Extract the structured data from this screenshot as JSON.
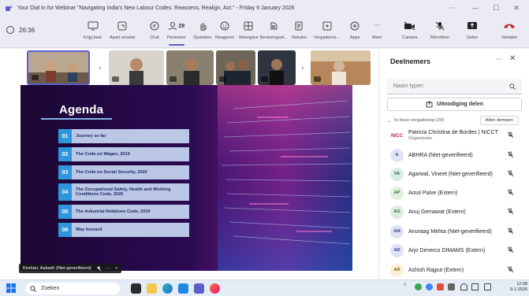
{
  "window": {
    "title": "Your Dial In for Webinar \"Navigating India's New Labour Codes: Reassess, Realign, Act.\" - Friday 9 January 2026",
    "controls": [
      "···",
      "—",
      "☐",
      "✕"
    ]
  },
  "toolbar": {
    "timer": "26:36",
    "buttons": [
      {
        "id": "raise",
        "label": "Krijg besl."
      },
      {
        "id": "separate",
        "label": "Apart venster"
      },
      {
        "id": "chat",
        "label": "Chat"
      },
      {
        "id": "people",
        "label": "Personen",
        "count": "29"
      },
      {
        "id": "raise-hand",
        "label": "Opsteken"
      },
      {
        "id": "react",
        "label": "Reageren"
      },
      {
        "id": "view",
        "label": "Weergave"
      },
      {
        "id": "controls",
        "label": "Besturingsel..."
      },
      {
        "id": "notes",
        "label": "Notulen"
      },
      {
        "id": "rooms",
        "label": "Vergaderrui..."
      },
      {
        "id": "apps",
        "label": "Apps"
      },
      {
        "id": "more",
        "label": "Meer"
      },
      {
        "id": "camera",
        "label": "Camera"
      },
      {
        "id": "mic",
        "label": "Microfoon"
      },
      {
        "id": "share",
        "label": "Delen"
      },
      {
        "id": "leave",
        "label": "Verlaten"
      }
    ]
  },
  "slide": {
    "title": "Agenda",
    "items": [
      {
        "num": "01",
        "text": "Journey so far"
      },
      {
        "num": "02",
        "text": "The Code on Wages, 2019"
      },
      {
        "num": "03",
        "text": "The Code on Social Security, 2020"
      },
      {
        "num": "04",
        "text": "The Occupational Safety, Health and Working Conditions Code, 2020"
      },
      {
        "num": "05",
        "text": "The Industrial Relations Code, 2020"
      },
      {
        "num": "06",
        "text": "Way forward"
      }
    ]
  },
  "presenter": {
    "name": "Keshari, Aakash (Niet-geverifieerd)"
  },
  "panel": {
    "title": "Deelnemers",
    "search_placeholder": "Naam typen",
    "invite_label": "Uitnodiging delen",
    "section_label": "In deze vergadering (29)",
    "mute_all": "Allen dempen",
    "participants": [
      {
        "initials": "NICC",
        "name": "Patricia Christina de Bordes | NICCT",
        "role": "Organisator",
        "color": "#ffffff",
        "fg": "#c4262e"
      },
      {
        "initials": "A",
        "name": "ABHRA (Niet-geverifieerd)",
        "role": "",
        "color": "#dfe3f5",
        "fg": "#3b3f8f"
      },
      {
        "initials": "VA",
        "name": "Agarwal, Vineet (Niet-geverifieerd)",
        "role": "",
        "color": "#d8ece4",
        "fg": "#2d6a4f"
      },
      {
        "initials": "AP",
        "name": "Amol Palve (Extern)",
        "role": "",
        "color": "#dff0dc",
        "fg": "#3d6b36"
      },
      {
        "initials": "AG",
        "name": "Anuj Gemawat (Extern)",
        "role": "",
        "color": "#dcecdf",
        "fg": "#35693f"
      },
      {
        "initials": "AM",
        "name": "Anuraag Mehta (Niet-geverifieerd)",
        "role": "",
        "color": "#dfe3f5",
        "fg": "#3b3f8f"
      },
      {
        "initials": "AD",
        "name": "Arjo Dimerco DIMAMS (Extern)",
        "role": "",
        "color": "#dfe3f5",
        "fg": "#3b3f8f"
      },
      {
        "initials": "AR",
        "name": "Ashish Rajput (Extern)",
        "role": "",
        "color": "#fbefd6",
        "fg": "#8a5a00"
      }
    ]
  },
  "taskbar": {
    "search_label": "Zoeken",
    "time": "12:08",
    "date": "9-1-2026"
  },
  "colors": {
    "accent": "#5b5fc7",
    "leave": "#c4262e",
    "slide_number_bg": "#2e97dc",
    "slide_item_bg": "#bcc7e6"
  }
}
